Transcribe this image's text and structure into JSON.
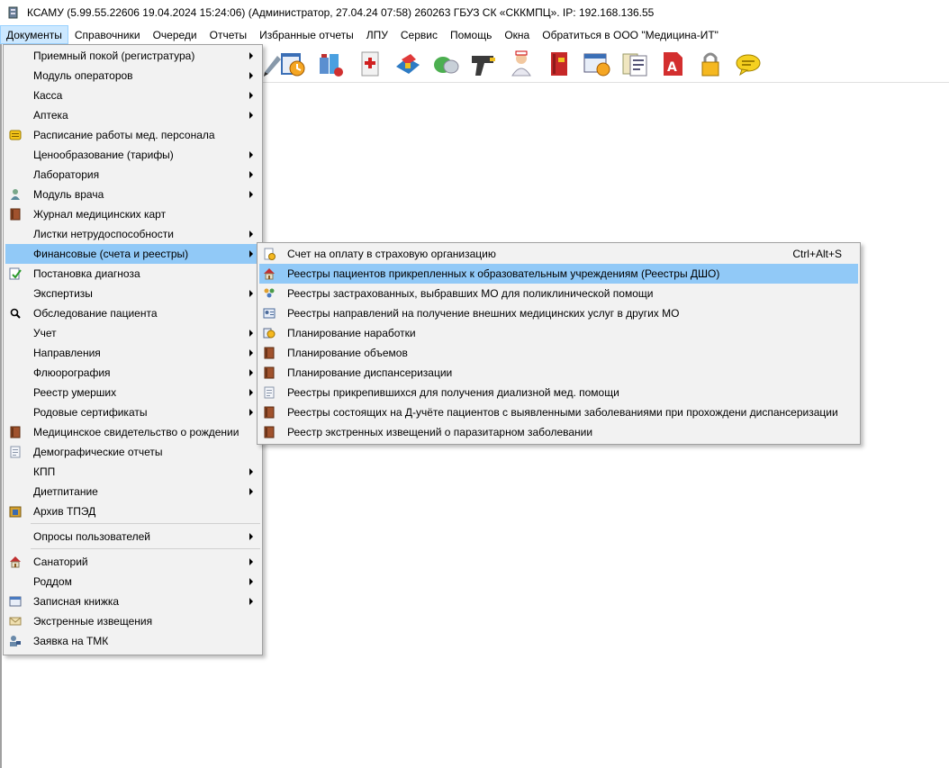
{
  "window": {
    "title": "КСАМУ (5.99.55.22606 19.04.2024 15:24:06) (Администратор, 27.04.24 07:58)  260263 ГБУЗ СК «СККМПЦ». IP: 192.168.136.55"
  },
  "menubar": {
    "items": [
      {
        "label": "Документы"
      },
      {
        "label": "Справочники"
      },
      {
        "label": "Очереди"
      },
      {
        "label": "Отчеты"
      },
      {
        "label": "Избранные отчеты"
      },
      {
        "label": "ЛПУ"
      },
      {
        "label": "Сервис"
      },
      {
        "label": "Помощь"
      },
      {
        "label": "Окна"
      },
      {
        "label": "Обратиться в ООО \"Медицина-ИТ\""
      }
    ]
  },
  "documents_menu": {
    "items": [
      {
        "label": "Приемный покой (регистратура)"
      },
      {
        "label": "Модуль операторов"
      },
      {
        "label": "Касса"
      },
      {
        "label": "Аптека"
      },
      {
        "label": "Расписание работы мед. персонала"
      },
      {
        "label": "Ценообразование (тарифы)"
      },
      {
        "label": "Лаборатория"
      },
      {
        "label": "Модуль врача"
      },
      {
        "label": "Журнал медицинских карт"
      },
      {
        "label": "Листки нетрудоспособности"
      },
      {
        "label": "Финансовые (счета и реестры)"
      },
      {
        "label": "Постановка диагноза"
      },
      {
        "label": "Экспертизы"
      },
      {
        "label": "Обследование пациента"
      },
      {
        "label": "Учет"
      },
      {
        "label": "Направления"
      },
      {
        "label": "Флюорография"
      },
      {
        "label": "Реестр умерших"
      },
      {
        "label": "Родовые сертификаты"
      },
      {
        "label": "Медицинское свидетельство о рождении"
      },
      {
        "label": "Демографические отчеты"
      },
      {
        "label": "КПП"
      },
      {
        "label": "Диетпитание"
      },
      {
        "label": "Архив ТПЭД"
      },
      {
        "label": "Опросы пользователей"
      },
      {
        "label": "Санаторий"
      },
      {
        "label": "Роддом"
      },
      {
        "label": "Записная книжка"
      },
      {
        "label": "Экстренные извещения"
      },
      {
        "label": "Заявка на ТМК"
      }
    ]
  },
  "finance_submenu": {
    "items": [
      {
        "label": "Счет на оплату в страховую организацию",
        "shortcut": "Ctrl+Alt+S"
      },
      {
        "label": "Реестры пациентов прикрепленных к образовательным учреждениям (Реестры ДШО)"
      },
      {
        "label": "Реестры застрахованных, выбравших МО для поликлинической помощи"
      },
      {
        "label": "Реестры направлений на получение внешних медицинских услуг в других МО"
      },
      {
        "label": "Планирование наработки"
      },
      {
        "label": "Планирование объемов"
      },
      {
        "label": "Планирование диспансеризации"
      },
      {
        "label": "Реестры прикрепившихся для получения диализной мед. помощи"
      },
      {
        "label": "Реестры состоящих на Д-учёте пациентов с выявленными заболеваниями при прохождени диспансеризации"
      },
      {
        "label": "Реестр экстренных извещений о паразитарном заболевании"
      }
    ]
  }
}
